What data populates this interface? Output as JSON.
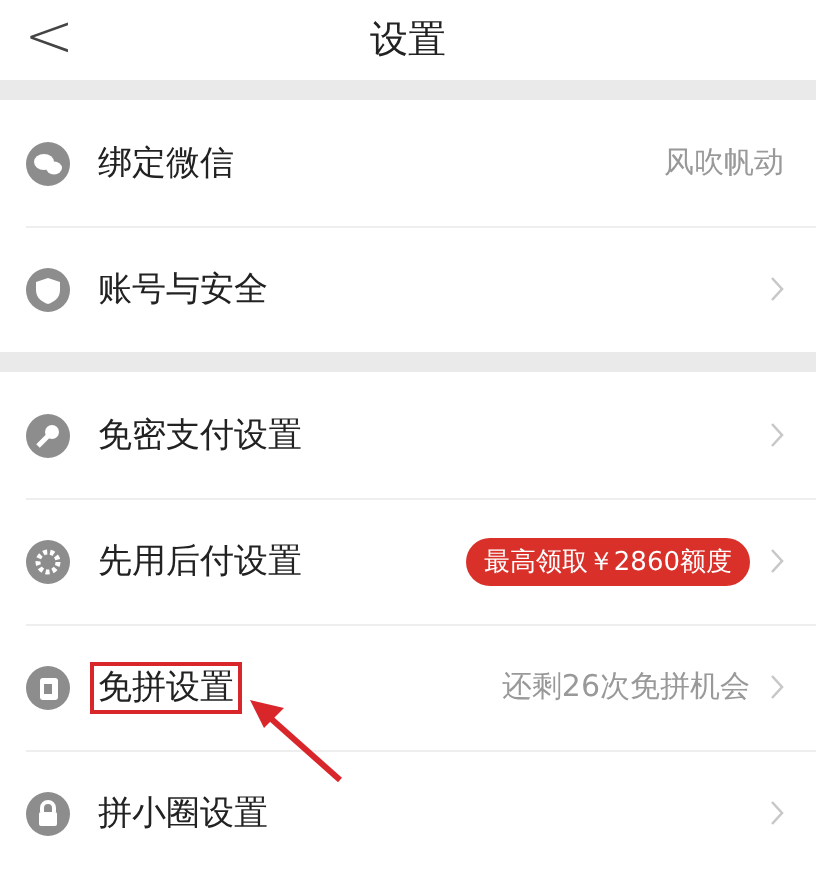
{
  "header": {
    "back": "<",
    "title": "设置"
  },
  "groups": [
    {
      "rows": [
        {
          "kind": "chat",
          "label": "绑定微信",
          "value": "风吹帆动",
          "chevron": false,
          "highlighted": false
        },
        {
          "kind": "shield",
          "label": "账号与安全",
          "chevron": true,
          "highlighted": false
        }
      ]
    },
    {
      "rows": [
        {
          "kind": "key",
          "label": "免密支付设置",
          "chevron": true,
          "highlighted": false
        },
        {
          "kind": "gear",
          "label": "先用后付设置",
          "badge": "最高领取￥2860额度",
          "chevron": true,
          "highlighted": false
        },
        {
          "kind": "card",
          "label": "免拼设置",
          "value": "还剩26次免拼机会",
          "chevron": true,
          "highlighted": true
        },
        {
          "kind": "lock",
          "label": "拼小圈设置",
          "chevron": true,
          "highlighted": false
        }
      ]
    }
  ]
}
